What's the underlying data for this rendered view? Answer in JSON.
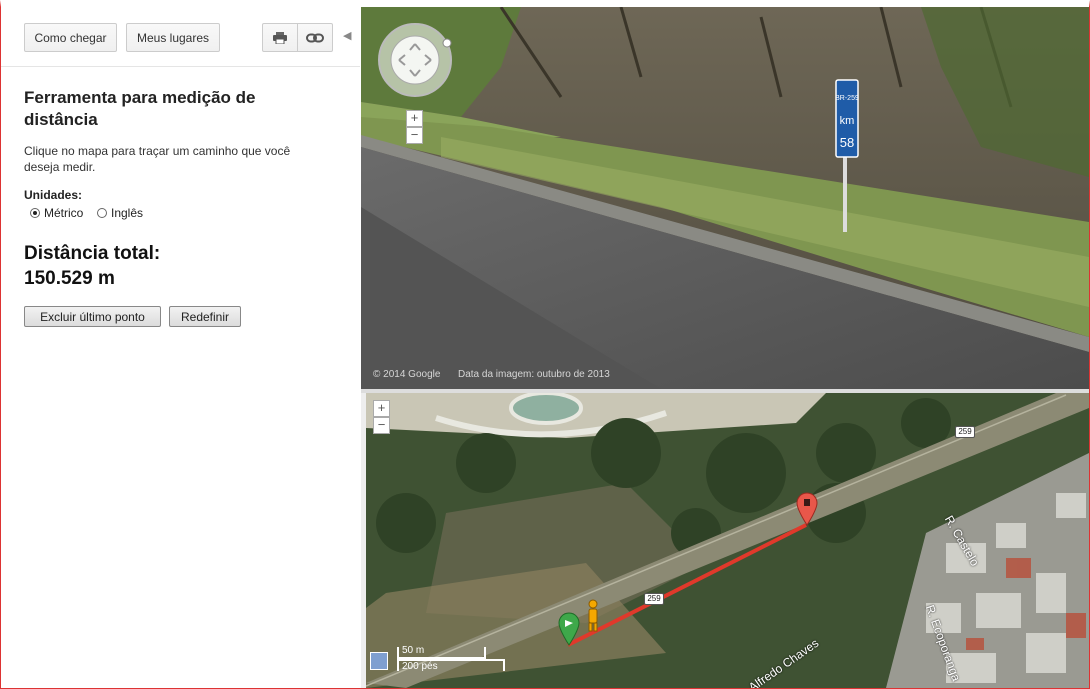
{
  "toolbar": {
    "directions_label": "Como chegar",
    "places_label": "Meus lugares",
    "print_icon": "printer-icon",
    "link_icon": "link-icon"
  },
  "tool": {
    "title": "Ferramenta para medição de distância",
    "description": "Clique no mapa para traçar um caminho que você deseja medir.",
    "units_label": "Unidades:",
    "unit_options": [
      "Métrico",
      "Inglês"
    ],
    "selected_unit": "Métrico",
    "total_label": "Distância total:",
    "total_value": "150.529 m",
    "undo_label": "Excluir último ponto",
    "reset_label": "Redefinir"
  },
  "street_view": {
    "copyright": "© 2014 Google",
    "image_date": "Data da imagem: outubro de 2013",
    "sign_lines": [
      "BR-259",
      "km",
      "58"
    ],
    "zoom_in": "+",
    "zoom_out": "−"
  },
  "map": {
    "zoom_in": "+",
    "zoom_out": "−",
    "route_shield": "259",
    "route_shield_2": "259",
    "streets": [
      "R. Castelo",
      "R. Ecoporanga",
      "Alfredo Chaves"
    ],
    "scale_metric": "50 m",
    "scale_imperial": "200 pés",
    "measure_line_color": "#e0392b"
  }
}
